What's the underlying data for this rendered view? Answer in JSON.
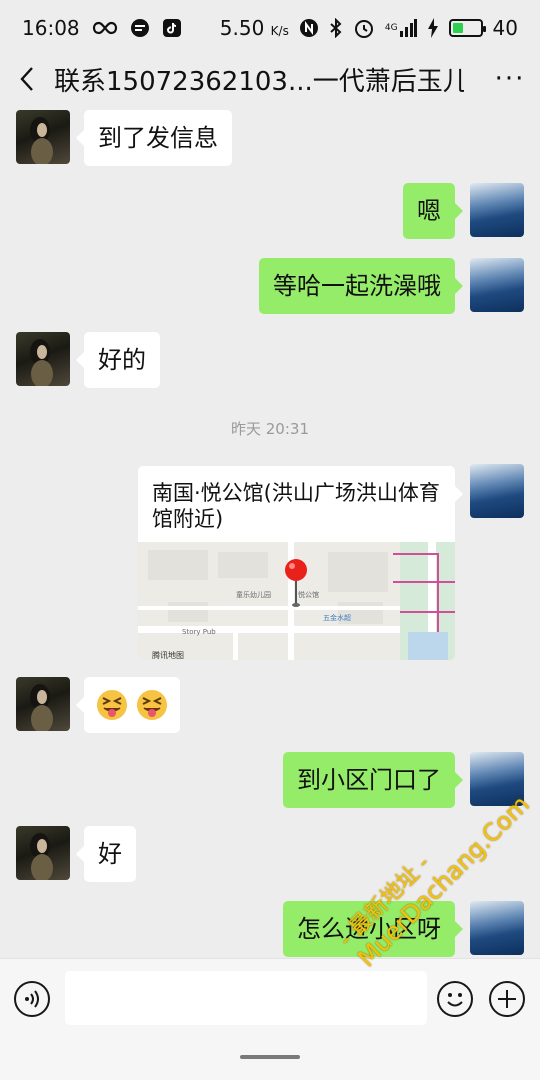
{
  "status_bar": {
    "time": "16:08",
    "net_speed": "5.50",
    "net_speed_unit": "K/s",
    "signal_label": "4G",
    "battery_level": "40",
    "battery_fraction": 0.4
  },
  "nav": {
    "title": "联系15072362103...一代萧后玉儿",
    "more_label": "···"
  },
  "messages": [
    {
      "side": "in",
      "text": "到了发信息"
    },
    {
      "side": "out",
      "text": "嗯"
    },
    {
      "side": "out",
      "text": "等哈一起洗澡哦"
    },
    {
      "side": "in",
      "text": "好的"
    },
    {
      "side": "out",
      "text": "到小区门口了"
    },
    {
      "side": "in",
      "text": "好"
    },
    {
      "side": "out",
      "text": "怎么进小区呀"
    }
  ],
  "timestamp": "昨天 20:31",
  "location": {
    "name": "南国·悦公馆(洪山广场洪山体育馆附近)",
    "map_labels": {
      "poi_1": "悦公馆",
      "poi_2": "Story Pub",
      "poi_3": "五金水超",
      "provider": "腾讯地图",
      "school": "童乐幼儿园"
    }
  },
  "emoji_message": {
    "side": "in",
    "emoji": "squinting-face-with-tongue",
    "count": 2
  },
  "input_bar": {
    "placeholder": ""
  },
  "watermark": {
    "line1": "- 最新地址 -",
    "line2": "MuerDachang.Com"
  },
  "colors": {
    "bubble_out": "#95ec69",
    "bubble_in": "#ffffff",
    "background": "#ededed"
  }
}
